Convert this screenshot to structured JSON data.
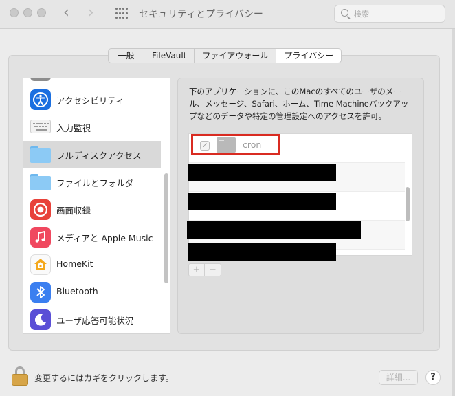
{
  "window": {
    "title": "セキュリティとプライバシー",
    "search_placeholder": "検索",
    "back_icon": "chevron-left-icon",
    "forward_icon": "chevron-right-icon"
  },
  "tabs": [
    {
      "label": "一般",
      "active": false
    },
    {
      "label": "FileVault",
      "active": false
    },
    {
      "label": "ファイアウォール",
      "active": false
    },
    {
      "label": "プライバシー",
      "active": true
    }
  ],
  "sidebar": {
    "items": [
      {
        "label": "アクセシビリティ",
        "icon": "accessibility-icon",
        "selected": false
      },
      {
        "label": "入力監視",
        "icon": "keyboard-icon",
        "selected": false
      },
      {
        "label": "フルディスクアクセス",
        "icon": "folder-icon",
        "selected": true
      },
      {
        "label": "ファイルとフォルダ",
        "icon": "folder-icon",
        "selected": false
      },
      {
        "label": "画面収録",
        "icon": "screen-record-icon",
        "selected": false
      },
      {
        "label": "メディアと Apple Music",
        "icon": "music-icon",
        "selected": false
      },
      {
        "label": "HomeKit",
        "icon": "homekit-icon",
        "selected": false
      },
      {
        "label": "Bluetooth",
        "icon": "bluetooth-icon",
        "selected": false
      },
      {
        "label": "ユーザ応答可能状況",
        "icon": "moon-icon",
        "selected": false
      }
    ]
  },
  "main": {
    "description": "下のアプリケーションに、このMacのすべてのユーザのメール、メッセージ、Safari、ホーム、Time Machineバックアップなどのデータや特定の管理設定へのアクセスを許可。",
    "apps": [
      {
        "name": "cron",
        "checked": true
      }
    ],
    "add_label": "+",
    "remove_label": "−"
  },
  "footer": {
    "lock_text": "変更するにはカギをクリックします。",
    "advanced_label": "詳細...",
    "help_label": "?"
  },
  "colors": {
    "highlight": "#d92b21",
    "selection": "#d9d9d9"
  }
}
